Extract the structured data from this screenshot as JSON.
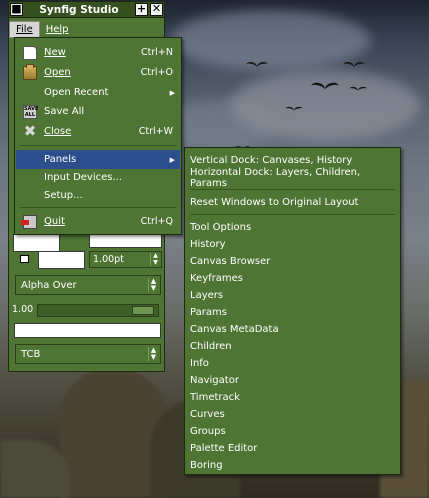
{
  "window": {
    "title": "Synfig Studio",
    "menubar": [
      {
        "label": "File",
        "mnemonic_index": 0
      },
      {
        "label": "Help",
        "mnemonic_index": 0
      }
    ]
  },
  "toolbox": {
    "outline_width": "1.00pt",
    "blend_method": "Alpha Over",
    "opacity": "1.00",
    "interpolation": "TCB"
  },
  "file_menu": {
    "items": [
      {
        "label": "New",
        "accel": "Ctrl+N",
        "icon": "new-file-icon"
      },
      {
        "label": "Open",
        "accel": "Ctrl+O",
        "icon": "open-folder-icon"
      },
      {
        "label": "Open Recent",
        "accel": "",
        "icon": "",
        "submenu": true
      },
      {
        "label": "Save All",
        "accel": "",
        "icon": "save-all-icon",
        "icon_text": "SAVE ALL"
      },
      {
        "label": "Close",
        "accel": "Ctrl+W",
        "icon": "close-icon"
      },
      {
        "label": "Panels",
        "accel": "",
        "icon": "",
        "submenu": true,
        "selected": true
      },
      {
        "label": "Input Devices...",
        "accel": "",
        "icon": ""
      },
      {
        "label": "Setup...",
        "accel": "",
        "icon": ""
      },
      {
        "label": "Quit",
        "accel": "Ctrl+Q",
        "icon": "quit-icon"
      }
    ]
  },
  "panels_menu": {
    "items": [
      "Vertical Dock: Canvases, History",
      "Horizontal Dock: Layers, Children, Params",
      "Reset Windows to Original Layout",
      "Tool Options",
      "History",
      "Canvas Browser",
      "Keyframes",
      "Layers",
      "Params",
      "Canvas MetaData",
      "Children",
      "Info",
      "Navigator",
      "Timetrack",
      "Curves",
      "Groups",
      "Palette Editor",
      "Boring"
    ]
  },
  "colors": {
    "panel_green": "#4f7534",
    "titlebar_green": "#36511f",
    "selection_blue": "#2d4e8d"
  }
}
